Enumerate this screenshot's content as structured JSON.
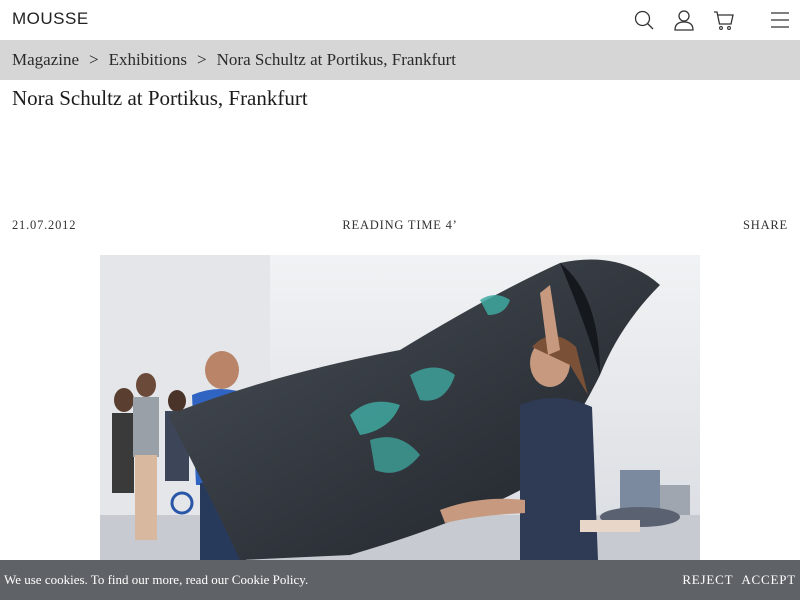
{
  "header": {
    "logo": "MOUSSE",
    "icons": [
      "search-icon",
      "user-icon",
      "cart-icon",
      "menu-icon"
    ]
  },
  "breadcrumb": {
    "items": [
      "Magazine",
      "Exhibitions",
      "Nora Schultz at Portikus, Frankfurt"
    ],
    "separator": ">"
  },
  "article": {
    "title": "Nora Schultz at Portikus, Frankfurt",
    "date": "21.07.2012",
    "reading_time": "READING TIME 4’",
    "share_label": "SHARE"
  },
  "cookie_banner": {
    "text": "We use cookies. To find our more, read our ",
    "link": "Cookie Policy",
    "link_suffix": ".",
    "reject_label": "REJECT",
    "accept_label": "ACCEPT"
  },
  "colors": {
    "breadcrumb_bg": "#d6d6d6",
    "cookie_bg": "#5f6266",
    "text": "#1a1a1a"
  }
}
